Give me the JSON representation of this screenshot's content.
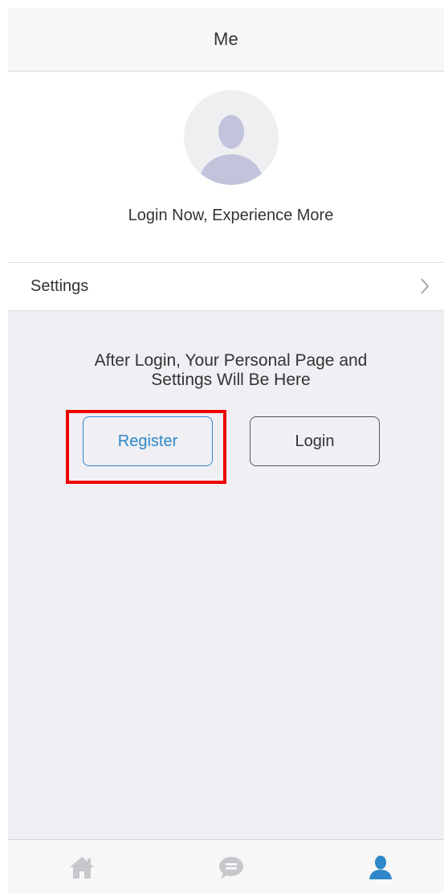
{
  "header": {
    "title": "Me"
  },
  "profile": {
    "avatar_icon": "user-silhouette-icon",
    "tagline": "Login Now, Experience More"
  },
  "settings_row": {
    "label": "Settings",
    "icon": "chevron-right-icon"
  },
  "content": {
    "info_line_1": "After Login, Your Personal Page and",
    "info_line_2": "Settings Will Be Here",
    "register_label": "Register",
    "login_label": "Login"
  },
  "tab_bar": {
    "tabs": [
      {
        "icon": "home-icon",
        "active": false
      },
      {
        "icon": "chat-bubble-icon",
        "active": false
      },
      {
        "icon": "user-icon",
        "active": true
      }
    ]
  },
  "colors": {
    "accent": "#2f87c9",
    "highlight": "#ee0000",
    "inactive_icon": "#c7c7cc",
    "background_gray": "#efeff4",
    "avatar_fill": "#c2c4dc"
  }
}
